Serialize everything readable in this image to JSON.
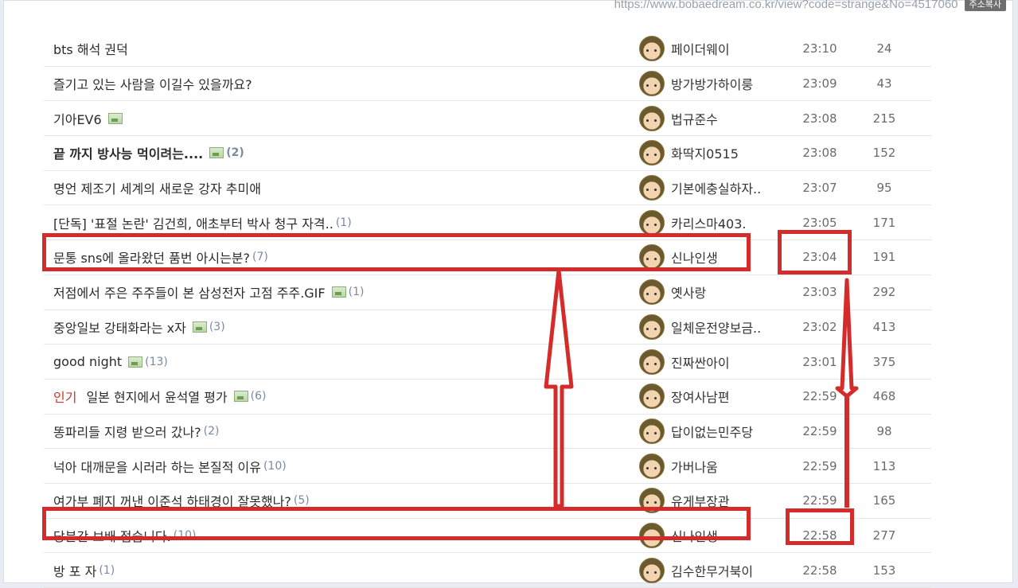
{
  "url": "https://www.bobaedream.co.kr/view?code=strange&No=4517060",
  "url_button": "주소복사",
  "accent": "#d42b2b",
  "rows": [
    {
      "title": "bts 해석 권덕",
      "author": "페이더웨이",
      "time": "23:10",
      "views": "24"
    },
    {
      "title": "즐기고 있는 사람을 이길수 있을까요?",
      "author": "방가방가하이룽",
      "time": "23:09",
      "views": "43"
    },
    {
      "title": "기아EV6",
      "pic": true,
      "author": "법규준수",
      "time": "23:08",
      "views": "215"
    },
    {
      "title": "끝 까지 방사능 먹이려는....",
      "bold": true,
      "pic": true,
      "count": "(2)",
      "author": "화딱지0515",
      "time": "23:08",
      "views": "152"
    },
    {
      "title": "명언 제조기 세계의 새로운 강자 추미애",
      "author": "기본에충실하자..",
      "time": "23:07",
      "views": "95"
    },
    {
      "title": "[단독] '표절 논란' 김건희, 애초부터 박사 청구 자격..",
      "count": "(1)",
      "author": "카리스마403.",
      "time": "23:05",
      "views": "171"
    },
    {
      "title": "문통 sns에 올라왔던 품번 아시는분?",
      "count": "(7)",
      "author": "신나인생",
      "time": "23:04",
      "views": "191"
    },
    {
      "title": "저점에서 주은 주주들이 본 삼성전자 고점 주주.GIF",
      "pic": true,
      "count": "(1)",
      "author": "옛사랑",
      "time": "23:03",
      "views": "292"
    },
    {
      "title": "중앙일보 강태화라는 x자",
      "pic": true,
      "count": "(3)",
      "author": "일체운전양보금..",
      "time": "23:02",
      "views": "413"
    },
    {
      "title": "good night",
      "pic": true,
      "count": "(13)",
      "author": "진짜싼아이",
      "time": "23:01",
      "views": "375"
    },
    {
      "tag": "인기",
      "title": "일본 현지에서 윤석열 평가",
      "pic": true,
      "count": "(6)",
      "author": "장여사남편",
      "time": "22:59",
      "views": "468"
    },
    {
      "title": "똥파리들 지령 받으러 갔나?",
      "count": "(2)",
      "author": "답이없는민주당",
      "time": "22:59",
      "views": "98"
    },
    {
      "title": "넉아 대깨문을 시러라 하는 본질적 이유",
      "count": "(10)",
      "author": "가버나움",
      "time": "22:59",
      "views": "113"
    },
    {
      "title": "여가부 폐지 꺼낸 이준석 하태경이 잘못했나?",
      "count": "(5)",
      "author": "유게부장관",
      "time": "22:59",
      "views": "165"
    },
    {
      "title": "당분간 보배 접습니다.",
      "count": "(10)",
      "author": "신나인생",
      "time": "22:58",
      "views": "277"
    },
    {
      "title": "방 포 자",
      "count": "(1)",
      "author": "김수한무거북이",
      "time": "22:58",
      "views": "153"
    }
  ]
}
